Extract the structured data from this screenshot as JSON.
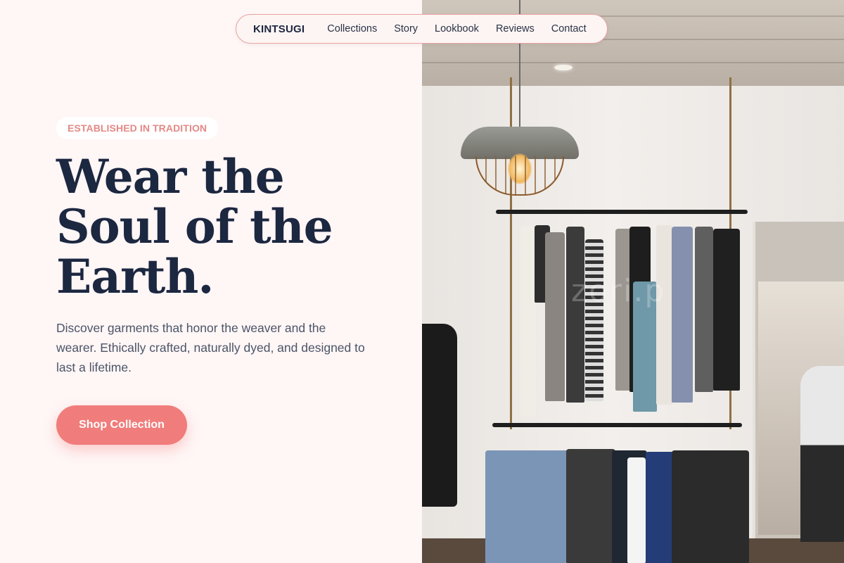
{
  "nav": {
    "brand": "KINTSUGI",
    "links": [
      "Collections",
      "Story",
      "Lookbook",
      "Reviews",
      "Contact"
    ]
  },
  "hero": {
    "eyebrow": "ESTABLISHED IN TRADITION",
    "headline_lines": [
      "Wear the",
      "Soul of the",
      "Earth."
    ],
    "description": "Discover garments that honor the weaver and the wearer. Ethically crafted, naturally dyed, and designed to last a lifetime.",
    "cta_label": "Shop Collection"
  },
  "image": {
    "subject": "clothing-store-interior-photo",
    "watermark": "zori.p"
  },
  "colors": {
    "accent": "#f07d7b",
    "eyebrow_text": "#e38986",
    "heading": "#1c2740",
    "body_text": "#4b5567",
    "background": "#fff6f6",
    "nav_border": "#e9a3a0"
  }
}
